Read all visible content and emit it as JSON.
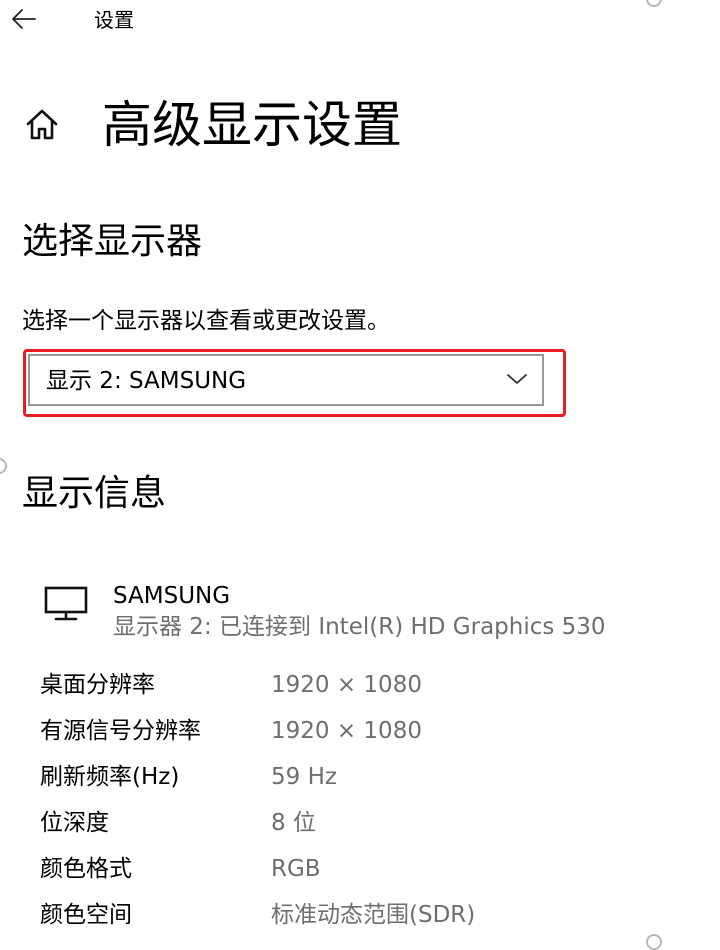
{
  "titlebar": {
    "back_icon": "arrow-left-icon",
    "title": "设置"
  },
  "header": {
    "home_icon": "home-icon",
    "title": "高级显示设置"
  },
  "select_display": {
    "heading": "选择显示器",
    "description": "选择一个显示器以查看或更改设置。",
    "dropdown": {
      "selected": "显示 2: SAMSUNG",
      "icon": "chevron-down-icon"
    },
    "highlight_color": "#e81e25"
  },
  "display_info": {
    "heading": "显示信息",
    "monitor": {
      "icon": "monitor-icon",
      "name": "SAMSUNG",
      "connection": "显示器 2: 已连接到 Intel(R) HD Graphics 530"
    },
    "properties": [
      {
        "label": "桌面分辨率",
        "value": "1920 × 1080"
      },
      {
        "label": "有源信号分辨率",
        "value": "1920 × 1080"
      },
      {
        "label": "刷新频率(Hz)",
        "value": "59 Hz"
      },
      {
        "label": "位深度",
        "value": "8 位"
      },
      {
        "label": "颜色格式",
        "value": "RGB"
      },
      {
        "label": "颜色空间",
        "value": "标准动态范围(SDR)"
      }
    ]
  }
}
